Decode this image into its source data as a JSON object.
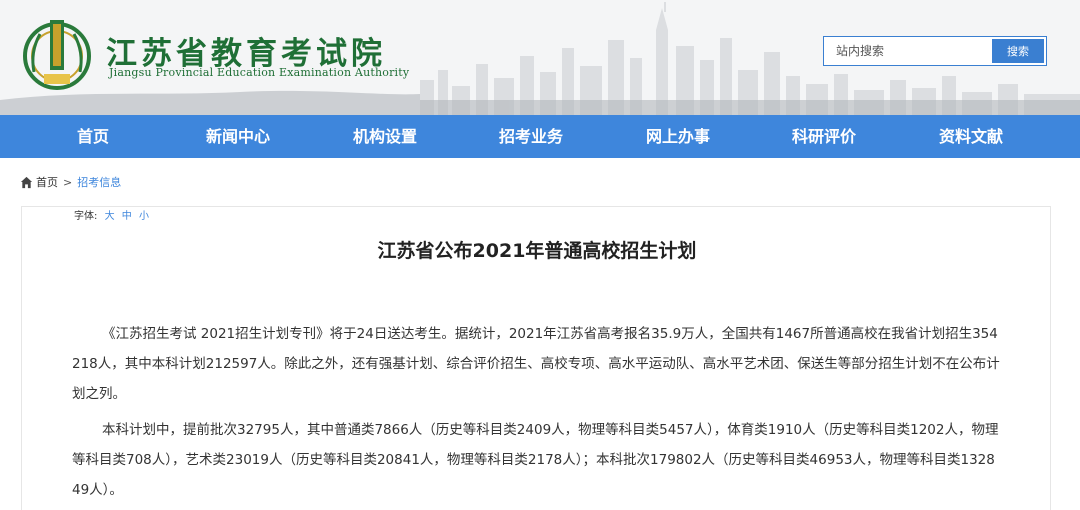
{
  "header": {
    "title": "江苏省教育考试院",
    "subtitle": "Jiangsu Provincial Education Examination Authority",
    "search": {
      "placeholder": "站内搜索",
      "button_label": "搜索"
    }
  },
  "nav": {
    "items": [
      {
        "label": "首页"
      },
      {
        "label": "新闻中心"
      },
      {
        "label": "机构设置"
      },
      {
        "label": "招考业务"
      },
      {
        "label": "网上办事"
      },
      {
        "label": "科研评价"
      },
      {
        "label": "资料文献"
      }
    ]
  },
  "breadcrumb": {
    "home": "首页",
    "separator": ">",
    "current": "招考信息"
  },
  "article": {
    "font_size_label": "字体:",
    "font_sizes": [
      "大",
      "中",
      "小"
    ],
    "title": "江苏省公布2021年普通高校招生计划",
    "paragraphs": [
      "《江苏招生考试 2021招生计划专刊》将于24日送达考生。据统计，2021年江苏省高考报名35.9万人，全国共有1467所普通高校在我省计划招生354218人，其中本科计划212597人。除此之外，还有强基计划、综合评价招生、高校专项、高水平运动队、高水平艺术团、保送生等部分招生计划不在公布计划之列。",
      "本科计划中，提前批次32795人，其中普通类7866人（历史等科目类2409人，物理等科目类5457人），体育类1910人（历史等科目类1202人，物理等科目类708人），艺术类23019人（历史等科目类20841人，物理等科目类2178人）；本科批次179802人（历史等科目类46953人，物理等科目类132849人）。"
    ]
  },
  "colors": {
    "nav_bg": "#3e86dc",
    "brand_green": "#1f6f36",
    "link_blue": "#3e86dc"
  }
}
